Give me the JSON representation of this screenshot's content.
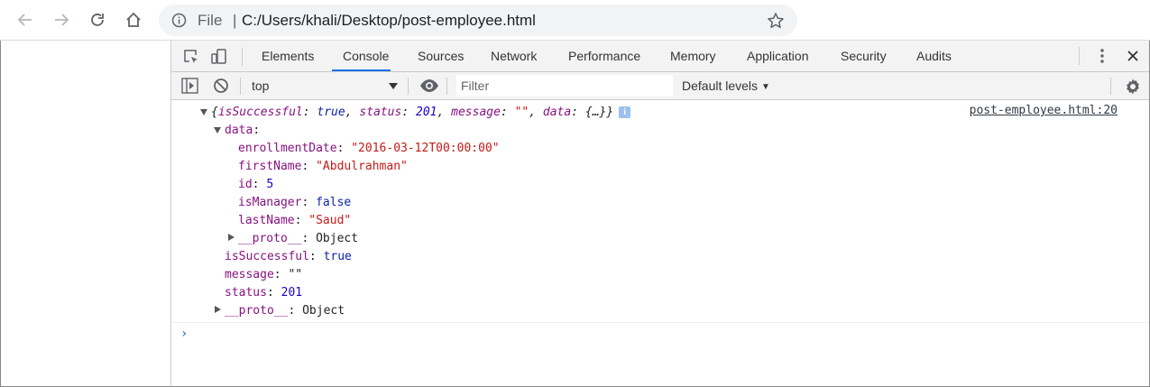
{
  "browser": {
    "scheme_label": "File",
    "separator": "|",
    "url": "C:/Users/khali/Desktop/post-employee.html"
  },
  "devtools": {
    "tabs": [
      "Elements",
      "Console",
      "Sources",
      "Network",
      "Performance",
      "Memory",
      "Application",
      "Security",
      "Audits"
    ],
    "active_tab": "Console",
    "console_bar": {
      "context": "top",
      "filter_placeholder": "Filter",
      "levels": "Default levels"
    }
  },
  "console": {
    "source_link": "post-employee.html:20",
    "summary": {
      "open_brace": "{",
      "k1": "isSuccessful",
      "v1": "true",
      "k2": "status",
      "v2": "201",
      "k3": "message",
      "v3": "\"\"",
      "k4": "data",
      "v4": "{…}",
      "close_brace": "}",
      "info": "i"
    },
    "data_key": "data",
    "data_fields": [
      {
        "key": "enrollmentDate",
        "value": "\"2016-03-12T00:00:00\"",
        "type": "string"
      },
      {
        "key": "firstName",
        "value": "\"Abdulrahman\"",
        "type": "string"
      },
      {
        "key": "id",
        "value": "5",
        "type": "number"
      },
      {
        "key": "isManager",
        "value": "false",
        "type": "bool"
      },
      {
        "key": "lastName",
        "value": "\"Saud\"",
        "type": "string"
      }
    ],
    "data_proto": {
      "key": "__proto__",
      "value": "Object"
    },
    "root_fields": [
      {
        "key": "isSuccessful",
        "value": "true",
        "type": "bool"
      },
      {
        "key": "message",
        "value": "\"\"",
        "type": "plain"
      },
      {
        "key": "status",
        "value": "201",
        "type": "number"
      }
    ],
    "root_proto": {
      "key": "__proto__",
      "value": "Object"
    },
    "prompt": "›"
  }
}
